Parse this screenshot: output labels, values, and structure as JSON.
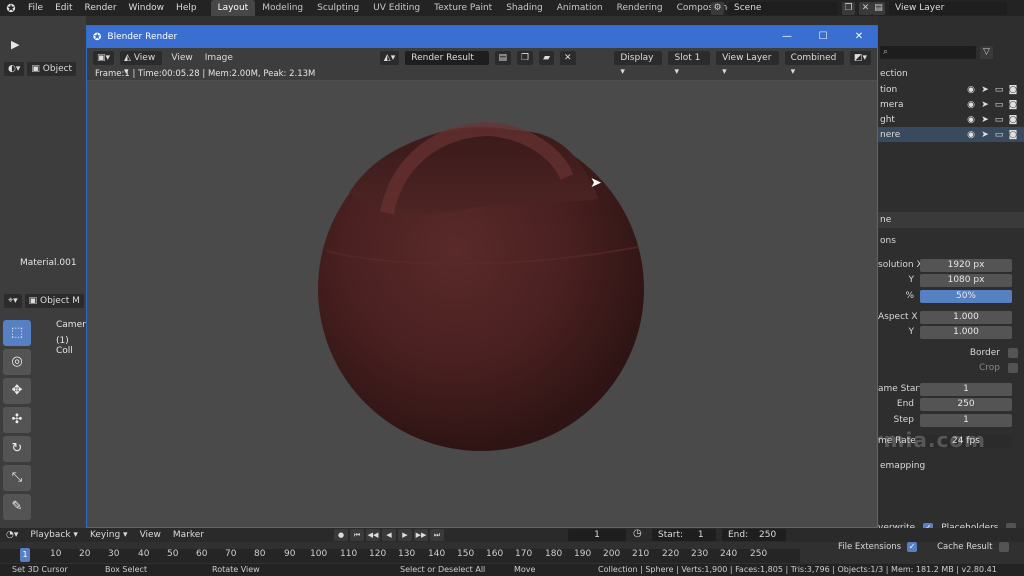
{
  "topbar": {
    "menus": [
      "File",
      "Edit",
      "Render",
      "Window",
      "Help"
    ],
    "workspaces": [
      "Layout",
      "Modeling",
      "Sculpting",
      "UV Editing",
      "Texture Paint",
      "Shading",
      "Animation",
      "Rendering",
      "Compositing"
    ],
    "active_workspace": "Layout",
    "scene": "Scene",
    "view_layer": "View Layer"
  },
  "viewport": {
    "mode": "Object",
    "mode2": "Object M",
    "material_label": "Material.001",
    "camera_label": "Camera",
    "collection_label": "(1) Coll"
  },
  "render_window": {
    "title": "Blender Render",
    "header": {
      "view": "View",
      "view2": "View",
      "image": "Image",
      "image_name": "Render Result",
      "display": "Display",
      "slot": "Slot 1",
      "view_layer": "View Layer",
      "pass": "Combined"
    },
    "info": "Frame:1 | Time:00:05.28 | Mem:2.00M, Peak: 2.13M"
  },
  "outliner": {
    "header": "ection",
    "rows": [
      {
        "name": "tion",
        "selected": false
      },
      {
        "name": "mera",
        "selected": false
      },
      {
        "name": "ght",
        "selected": false
      },
      {
        "name": "nere",
        "selected": true
      }
    ]
  },
  "properties": {
    "section_header": "ne",
    "subheader": "ons",
    "res_x_label": "solution X",
    "res_x": "1920 px",
    "res_y_label": "Y",
    "res_y": "1080 px",
    "percent_label": "%",
    "percent": "50%",
    "percent_fraction": 0.5,
    "aspect_x_label": "Aspect X",
    "aspect_x": "1.000",
    "aspect_y_label": "Y",
    "aspect_y": "1.000",
    "border_label": "Border",
    "crop_label": "Crop",
    "frame_start_label": "ame Start",
    "frame_start": "1",
    "end_label": "End",
    "end": "250",
    "step_label": "Step",
    "step": "1",
    "frame_rate_label": "me Rate",
    "frame_rate": "24 fps",
    "remapping_label": "emapping",
    "overwrite_label": "verwrite",
    "placeholders_label": "Placeholders",
    "file_ext_label": "File Extensions",
    "cache_result_label": "Cache Result"
  },
  "watermark": "www.honararmia.com",
  "timeline": {
    "menus": [
      "Playback",
      "Keying",
      "View",
      "Marker"
    ],
    "current_frame": "1",
    "start_label": "Start:",
    "start": "1",
    "end_label": "End:",
    "end": "250",
    "ticks": [
      "10",
      "20",
      "30",
      "40",
      "50",
      "60",
      "70",
      "80",
      "90",
      "100",
      "110",
      "120",
      "130",
      "140",
      "150",
      "160",
      "170",
      "180",
      "190",
      "200",
      "210",
      "220",
      "230",
      "240",
      "250"
    ],
    "playhead": "1"
  },
  "statusbar": {
    "a": "Set 3D Cursor",
    "b": "Box Select",
    "c": "Rotate View",
    "d": "Select or Deselect All",
    "e": "Move",
    "stats": "Collection | Sphere | Verts:1,900 | Faces:1,805 | Tris:3,796 | Objects:1/3 | Mem: 181.2 MB | v2.80.41"
  },
  "colors": {
    "accent": "#5680c2",
    "titlebar": "#3a6ed0",
    "sphere": "#4a2222"
  }
}
